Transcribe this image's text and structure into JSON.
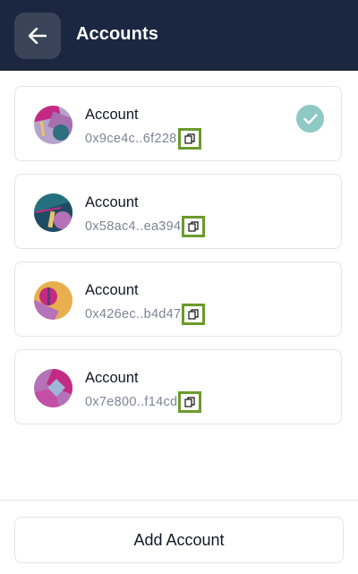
{
  "header": {
    "title": "Accounts",
    "back_icon": "arrow-left-icon"
  },
  "accounts": [
    {
      "name": "Account",
      "address": "0x9ce4c..6f228",
      "selected": true
    },
    {
      "name": "Account",
      "address": "0x58ac4..ea394",
      "selected": false
    },
    {
      "name": "Account",
      "address": "0x426ec..b4d47",
      "selected": false
    },
    {
      "name": "Account",
      "address": "0x7e800..f14cd",
      "selected": false
    }
  ],
  "icons": {
    "copy": "copy-icon",
    "check": "check-icon"
  },
  "colors": {
    "header_bg": "#1b2741",
    "selected_check": "#8ec9c4",
    "copy_highlight": "#6a9b2c"
  },
  "footer": {
    "add_account_label": "Add Account"
  }
}
